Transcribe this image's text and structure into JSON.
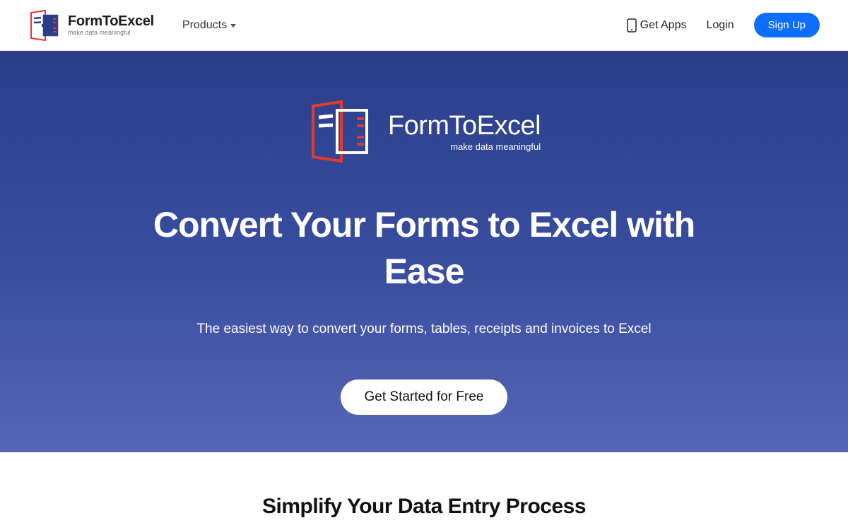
{
  "nav": {
    "brand_title": "FormToExcel",
    "brand_sub": "make data meaningful",
    "products_label": "Products",
    "getapps_label": "Get Apps",
    "login_label": "Login",
    "signup_label": "Sign Up"
  },
  "hero": {
    "logo_title": "FormToExcel",
    "logo_sub": "make data meaningful",
    "headline": "Convert Your Forms to Excel with Ease",
    "subtext": "The easiest way to convert your forms, tables, receipts and invoices to Excel",
    "cta_label": "Get Started for Free"
  },
  "section2": {
    "title": "Simplify Your Data Entry Process"
  },
  "colors": {
    "primary": "#0d6efd",
    "hero_top": "#2a3e8c",
    "hero_bottom": "#5766b6",
    "accent_red": "#e23b2e"
  }
}
